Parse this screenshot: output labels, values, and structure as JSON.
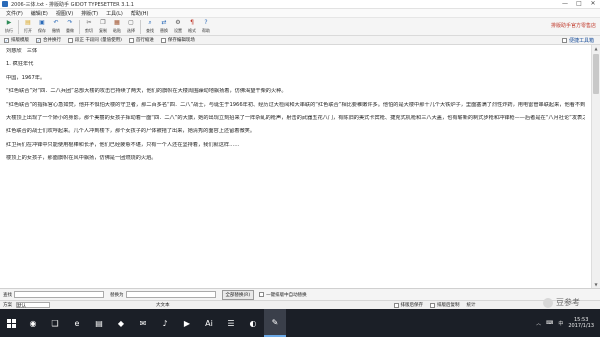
{
  "window": {
    "title": "2006-三体.txt - 排版助手 GIDOT TYPESETTER 3.1.1",
    "controls": [
      "—",
      "□",
      "✕"
    ]
  },
  "menu": [
    "文件(F)",
    "编辑(E)",
    "视图(V)",
    "排版(T)",
    "工具(L)",
    "帮助(H)"
  ],
  "toolbar": {
    "tools": [
      {
        "label": "执行",
        "icon": "run-icon",
        "glyph": "▶",
        "color": "#2e8b57"
      },
      {
        "label": "打开",
        "icon": "open-icon",
        "glyph": "▤",
        "color": "#d9a520"
      },
      {
        "label": "保存",
        "icon": "save-icon",
        "glyph": "▣",
        "color": "#2a6ab8"
      },
      {
        "label": "撤销",
        "icon": "undo-icon",
        "glyph": "↶",
        "color": "#2a6ab8"
      },
      {
        "label": "重做",
        "icon": "redo-icon",
        "glyph": "↷",
        "color": "#2a6ab8"
      },
      {
        "label": "剪切",
        "icon": "cut-icon",
        "glyph": "✂",
        "color": "#555555"
      },
      {
        "label": "复制",
        "icon": "copy-icon",
        "glyph": "❐",
        "color": "#555555"
      },
      {
        "label": "粘贴",
        "icon": "paste-icon",
        "glyph": "▦",
        "color": "#a0522d"
      },
      {
        "label": "选择",
        "icon": "select-icon",
        "glyph": "▢",
        "color": "#555555"
      },
      {
        "label": "查找",
        "icon": "find-icon",
        "glyph": "⌕",
        "color": "#2a6ab8"
      },
      {
        "label": "替换",
        "icon": "replace-icon",
        "glyph": "⇄",
        "color": "#2a6ab8"
      },
      {
        "label": "设置",
        "icon": "settings-icon",
        "glyph": "⚙",
        "color": "#555555"
      },
      {
        "label": "格式",
        "icon": "format-icon",
        "glyph": "¶",
        "color": "#c0392b"
      },
      {
        "label": "帮助",
        "icon": "help-icon",
        "glyph": "?",
        "color": "#2a6ab8"
      }
    ],
    "promo": "排版助手官方零售店"
  },
  "options": {
    "items": [
      {
        "label": "排版模版",
        "checked": true
      },
      {
        "label": "合并换行",
        "checked": true
      },
      {
        "label": "段正 干段同 (量值使用)",
        "checked": false
      },
      {
        "label": "首行缩进",
        "checked": false
      },
      {
        "label": "保存编辑现场",
        "checked": false
      }
    ],
    "right_link": "便捷工具箱"
  },
  "document": {
    "lines": [
      "刘慈欣　三体",
      "",
      "1. 疯狂年代",
      "",
      "中国，1967年。",
      "",
      "“红色联合”对“四．二八兵团”总部大楼的攻击已持续了两天，他们的旗帜在大楼周围躁动地飘扬着，仿佛渴望干柴的火种。",
      "",
      "“红色联合”的指挥官心急如焚，他并不惧怕大楼的守卫者，那二百多名“四．二八”战士，与诞生于1966年初、经历过大检阅和大串联的“红色联合”相比要稚嫩许多。他怕的是大楼中那十几个大铁炉子，里面塞满了烈性炸药，用电雷管串联起来，他看不到它们，但能感觉到它们磁石般的存在。开关一合，玉石俱焚，而“四．二八”的那些小红卫兵们是有这个精神力量的。比起已在风雨中成熟了许多的第一代红卫兵，新生的造反派们像火炭上的蚂蚁，除了疯狂还是疯狂。",
      "",
      "大楼顶上出现了一个娇小的身影，那个美丽的女孩子挥动着一面“四．二八”的大旗，她的出现立刻招来了一阵杂乱的枪声，射击的武器五花八门，有陈旧的美式卡宾枪、捷克式机枪和三八大盖，也有崭新的制式步枪和冲锋枪——后者是在“八月社论”发表之后从军队中偷抢来的，连同武器，大楼的女孩子手中的大旗在枪林弹雨中挥动，像一团燃烧的火焰，如同来自天界的事件在演变成悲剧。全国范围的武斗也进入高潮，）——该同那些较标和大刀等冷兵器，构成了一部浓缩的近现代史……“四．二八”的人在前面多次玩过这个游戏，在这一行动中，除了阳光，这个高尚圣洁的人的一切都在毁灭。",
      "",
      "红色联合的战士们欢呼起来。几个人冲到楼下，那个女孩子的尸体被拖了出来，她清秀的面容上还留着微笑。",
      "",
      "红卫兵们在冲锋中只能使用棍棒和长矛，他们已经疲惫不堪，只有一个人还在坚持着，我们就这样……",
      "",
      "楼顶上的女孩子，那面旗帜在风中飘扬，仿佛是一团燃烧的火焰。"
    ]
  },
  "find": {
    "find_label": "查找",
    "replace_label": "替换为",
    "replace_all": "全部替换(R)",
    "option": "一键排版中自动替换"
  },
  "status": {
    "scheme_label": "方案",
    "scheme_value": "默认",
    "encoding": "大文本",
    "right_opts": [
      "排版后保存",
      "排版后复制",
      "统计"
    ]
  },
  "watermark": "豆参考",
  "taskbar": {
    "items": [
      "◉",
      "❑",
      "e",
      "▤",
      "◆",
      "✉",
      "♪",
      "▶",
      "Ai",
      "☰",
      "◐",
      "✎"
    ],
    "tray": [
      "︿",
      "⌨",
      "中"
    ],
    "time": "15:53",
    "date": "2017/1/13"
  }
}
